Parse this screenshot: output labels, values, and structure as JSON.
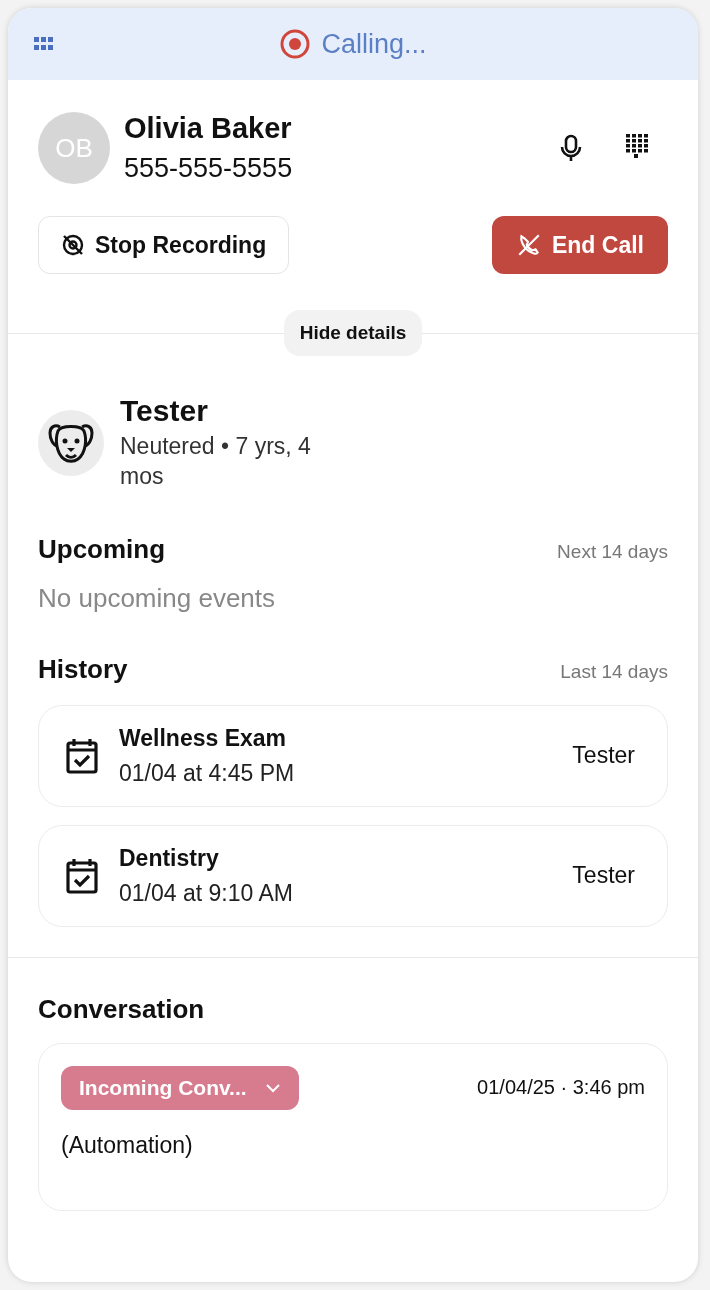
{
  "header": {
    "status": "Calling..."
  },
  "contact": {
    "initials": "OB",
    "name": "Olivia Baker",
    "phone": "555-555-5555"
  },
  "actions": [
    {
      "kind": "record",
      "label": "Stop Recording"
    },
    {
      "kind": "end",
      "label": "End Call"
    }
  ],
  "details_toggle": "Hide details",
  "pet": {
    "name": "Tester",
    "info": "Neutered • 7 yrs, 4 mos"
  },
  "upcoming": {
    "title": "Upcoming",
    "range": "Next 14 days",
    "empty": "No upcoming events"
  },
  "history": {
    "title": "History",
    "range": "Last 14 days",
    "items": [
      {
        "title": "Wellness Exam",
        "when": "01/04 at 4:45 PM",
        "pet": "Tester"
      },
      {
        "title": "Dentistry",
        "when": "01/04 at 9:10 AM",
        "pet": "Tester"
      }
    ]
  },
  "conversation": {
    "title": "Conversation",
    "tag": "Incoming Conv...",
    "time": "01/04/25 · 3:46 pm",
    "body": "(Automation)"
  }
}
